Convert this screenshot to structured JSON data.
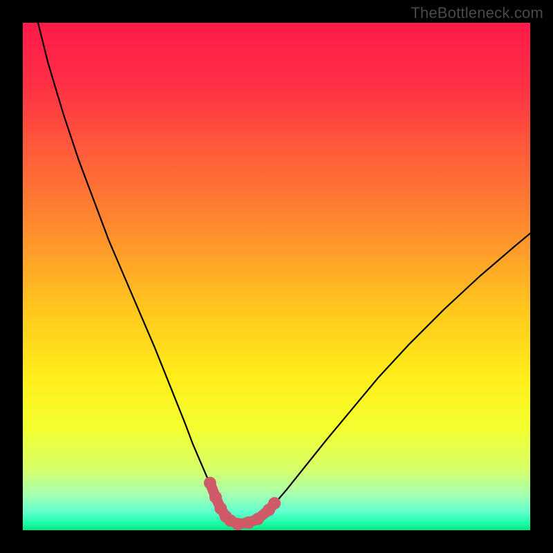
{
  "watermark": "TheBottleneck.com",
  "colors": {
    "frame": "#000000",
    "curve": "#000000",
    "marker": "#cf5b68",
    "gradient_stops": [
      {
        "offset": 0.0,
        "color": "#ff1a49"
      },
      {
        "offset": 0.12,
        "color": "#ff3045"
      },
      {
        "offset": 0.25,
        "color": "#ff5a3a"
      },
      {
        "offset": 0.4,
        "color": "#ff8a2f"
      },
      {
        "offset": 0.55,
        "color": "#ffc21f"
      },
      {
        "offset": 0.7,
        "color": "#ffee1a"
      },
      {
        "offset": 0.8,
        "color": "#f3ff30"
      },
      {
        "offset": 0.88,
        "color": "#d6ff6a"
      },
      {
        "offset": 0.93,
        "color": "#a6ffb0"
      },
      {
        "offset": 0.965,
        "color": "#5fffd0"
      },
      {
        "offset": 0.985,
        "color": "#1effa8"
      },
      {
        "offset": 1.0,
        "color": "#00e880"
      }
    ]
  },
  "chart_data": {
    "type": "line",
    "title": "",
    "xlabel": "",
    "ylabel": "",
    "xlim": [
      0,
      100
    ],
    "ylim": [
      0,
      100
    ],
    "grid": false,
    "legend": false,
    "series": [
      {
        "name": "bottleneck-curve",
        "x": [
          3,
          5,
          8,
          11,
          14,
          17,
          20,
          23,
          26,
          28,
          30,
          32,
          33.5,
          35,
          36.5,
          38,
          39,
          40,
          41,
          42,
          43.5,
          45,
          47,
          49,
          52,
          56,
          60,
          65,
          70,
          76,
          83,
          90,
          97,
          100
        ],
        "y": [
          100,
          92,
          82,
          73,
          65,
          57,
          50,
          43,
          36,
          31,
          26,
          21,
          17,
          13.5,
          10,
          7,
          4.7,
          3,
          2,
          1.4,
          1.1,
          1.4,
          2.5,
          4.5,
          8,
          13,
          18,
          24,
          30,
          36.5,
          43.5,
          50,
          56,
          58.5
        ]
      }
    ],
    "markers": {
      "name": "highlight-points",
      "x": [
        36.9,
        38.0,
        39.0,
        40.0,
        40.9,
        42.4,
        44.5,
        46.3,
        48.5,
        49.6
      ],
      "y": [
        9.3,
        6.5,
        4.3,
        2.7,
        1.9,
        1.2,
        1.5,
        2.2,
        4.0,
        5.3
      ]
    }
  }
}
